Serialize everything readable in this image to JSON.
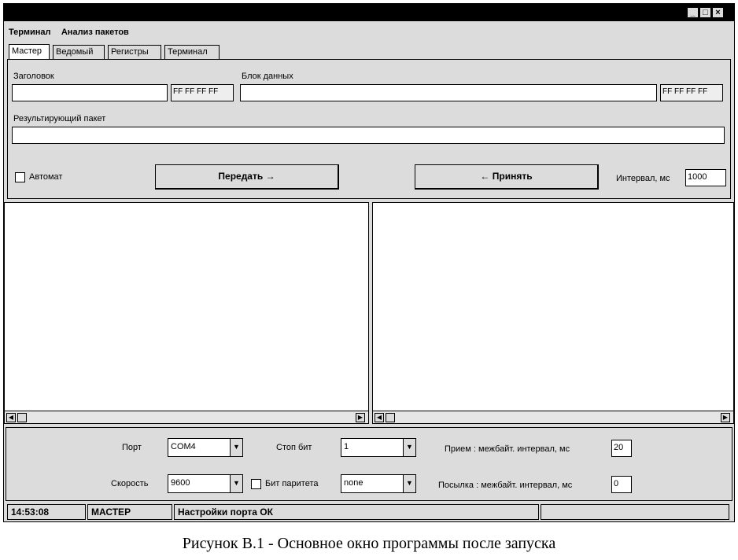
{
  "menu": {
    "items": [
      "Терминал",
      "Анализ пакетов"
    ]
  },
  "tabs": [
    "Мастер",
    "Ведомый",
    "Регистры",
    "Терминал"
  ],
  "master": {
    "header_label": "Заголовок",
    "header_value": "",
    "header_hex": "FF FF FF FF",
    "data_label": "Блок данных",
    "data_value": "",
    "data_hex": "FF FF FF FF",
    "result_label": "Результирующий пакет",
    "result_value": "",
    "auto_label": "Автомат",
    "send_label": "Передать",
    "receive_label": "Принять",
    "interval_label": "Интервал, мс",
    "interval_value": "1000"
  },
  "settings": {
    "port_label": "Порт",
    "port_value": "COM4",
    "stop_bits_label": "Стоп бит",
    "stop_bits_value": "1",
    "rx_interval_label": "Прием : межбайт. интервал, мс",
    "rx_interval_value": "20",
    "speed_label": "Скорость",
    "speed_value": "9600",
    "parity_label": "Бит паритета",
    "parity_value": "none",
    "tx_interval_label": "Посылка : межбайт. интервал, мс",
    "tx_interval_value": "0"
  },
  "status": {
    "time": "14:53:08",
    "mode": "МАСТЕР",
    "message": "Настройки порта ОК"
  },
  "caption": "Рисунок В.1 - Основное окно программы после запуска",
  "colors": {
    "window_bg": "#dcdcdc",
    "titlebar": "#000000",
    "pane_bg": "#ffffff"
  }
}
